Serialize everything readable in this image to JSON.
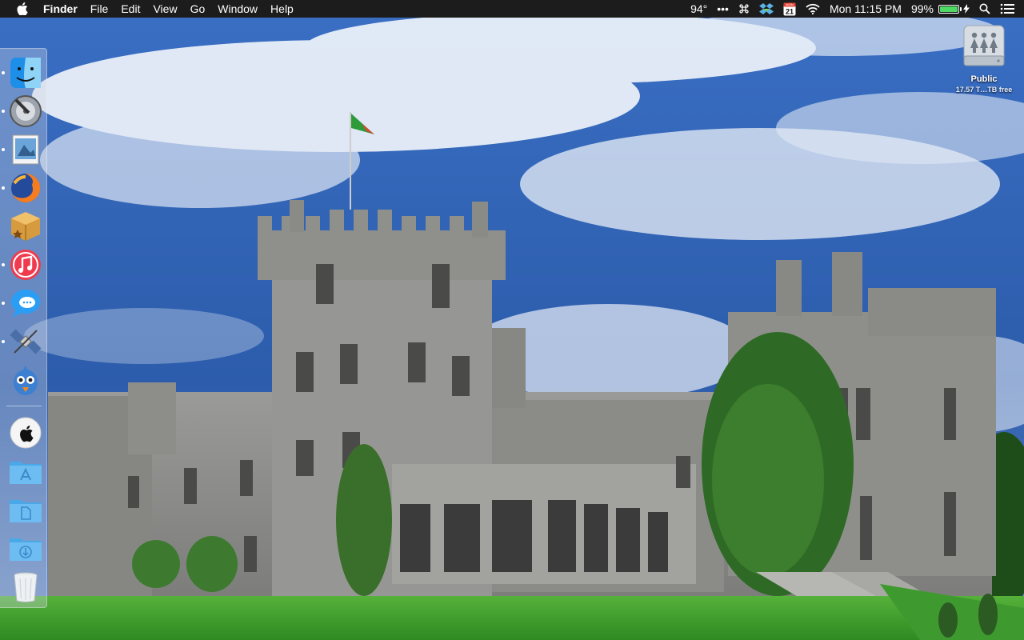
{
  "menubar": {
    "apple_icon": "apple-logo-icon",
    "app_name": "Finder",
    "items": [
      "File",
      "Edit",
      "View",
      "Go",
      "Window",
      "Help"
    ],
    "status": {
      "temperature": "94°",
      "more": "•••",
      "command_icon": "command-icon",
      "dropbox_icon": "dropbox-icon",
      "calendar_day": "MON",
      "calendar_date": "21",
      "wifi_icon": "wifi-icon",
      "clock": "Mon 11:15 PM",
      "battery_percent": "99%",
      "battery_level": 0.99,
      "battery_color": "#4cd964",
      "charging_icon": "lightning-icon",
      "search_icon": "spotlight-search-icon",
      "notifications_icon": "notification-center-icon"
    }
  },
  "dock": {
    "apps": [
      {
        "name": "Finder",
        "icon": "finder-icon",
        "running": true
      },
      {
        "name": "Disk Utility",
        "icon": "disk-utility-icon",
        "running": true
      },
      {
        "name": "Preview",
        "icon": "preview-icon",
        "running": true
      },
      {
        "name": "Firefox",
        "icon": "firefox-icon",
        "running": true
      },
      {
        "name": "Package",
        "icon": "package-icon",
        "running": false
      },
      {
        "name": "iTunes",
        "icon": "itunes-icon",
        "running": true
      },
      {
        "name": "Messages",
        "icon": "messages-icon",
        "running": true
      },
      {
        "name": "System Utility",
        "icon": "satellite-icon",
        "running": true
      },
      {
        "name": "Tweetbot",
        "icon": "tweetbot-icon",
        "running": false
      }
    ],
    "stacks": [
      {
        "name": "Apple",
        "icon": "apple-stack-icon"
      },
      {
        "name": "Applications",
        "icon": "applications-folder-icon"
      },
      {
        "name": "Documents",
        "icon": "documents-folder-icon"
      },
      {
        "name": "Downloads",
        "icon": "downloads-folder-icon"
      },
      {
        "name": "Trash",
        "icon": "trash-icon"
      }
    ]
  },
  "desktop": {
    "drive": {
      "label": "Public",
      "subtitle": "17.57 T…TB free",
      "icon": "network-drive-icon"
    },
    "wallpaper": "castle-wallpaper"
  },
  "colors": {
    "menubar": "#1c1c1c",
    "sky": "#2f5fae",
    "grass": "#3f9a2e",
    "stone": "#8e8f8c"
  }
}
